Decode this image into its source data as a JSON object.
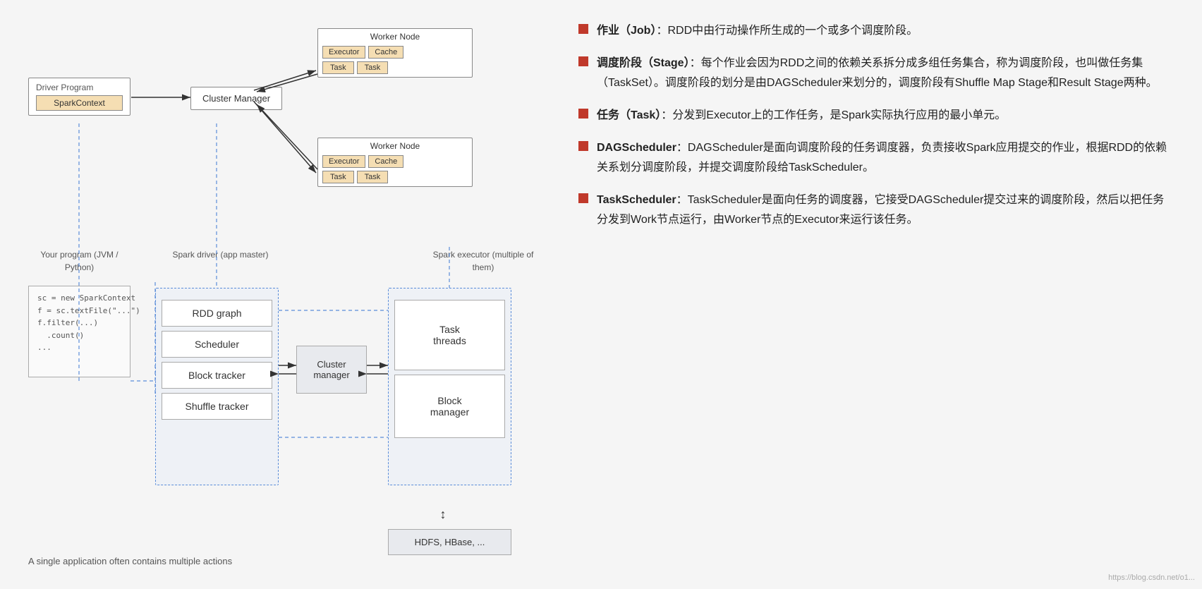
{
  "diagram": {
    "worker_node_1": {
      "label": "Worker Node",
      "executor": "Executor",
      "cache": "Cache",
      "task1": "Task",
      "task2": "Task"
    },
    "worker_node_2": {
      "label": "Worker Node",
      "executor": "Executor",
      "cache": "Cache",
      "task1": "Task",
      "task2": "Task"
    },
    "driver_program": {
      "label": "Driver Program",
      "spark_context": "SparkContext"
    },
    "cluster_manager_top": "Cluster Manager",
    "code": "sc = new SparkContext\nf = sc.textFile(\"...\")\nf.filter(...)\n  .count()\n...",
    "caption_program": "Your program\n(JVM / Python)",
    "caption_driver": "Spark driver\n(app master)",
    "caption_executor": "Spark executor\n(multiple of them)",
    "driver_items": [
      "RDD graph",
      "Scheduler",
      "Block tracker",
      "Shuffle tracker"
    ],
    "cluster_manager_center": "Cluster\nmanager",
    "executor_items": [
      "Task\nthreads",
      "Block\nmanager"
    ],
    "hdfs": "HDFS, HBase, ...",
    "bottom_caption": "A single application often contains multiple actions"
  },
  "bullets": [
    {
      "title": "作业（Job）",
      "text": "：RDD中由行动操作所生成的一个或多个调度阶段。"
    },
    {
      "title": "调度阶段（Stage）",
      "text": "：每个作业会因为RDD之间的依赖关系拆分成多组任务集合，称为调度阶段，也叫做任务集（TaskSet）。调度阶段的划分是由DAGScheduler来划分的，调度阶段有Shuffle Map Stage和Result Stage两种。"
    },
    {
      "title": "任务（Task）",
      "text": "：分发到Executor上的工作任务，是Spark实际执行应用的最小单元。"
    },
    {
      "title": "DAGScheduler",
      "text": "：DAGScheduler是面向调度阶段的任务调度器，负责接收Spark应用提交的作业，根据RDD的依赖关系划分调度阶段，并提交调度阶段给TaskScheduler。"
    },
    {
      "title": "TaskScheduler",
      "text": "：TaskScheduler是面向任务的调度器，它接受DAGScheduler提交过来的调度阶段，然后以把任务分发到Work节点运行，由Worker节点的Executor来运行该任务。"
    }
  ],
  "watermark": "https://blog.csdn.net/o1..."
}
